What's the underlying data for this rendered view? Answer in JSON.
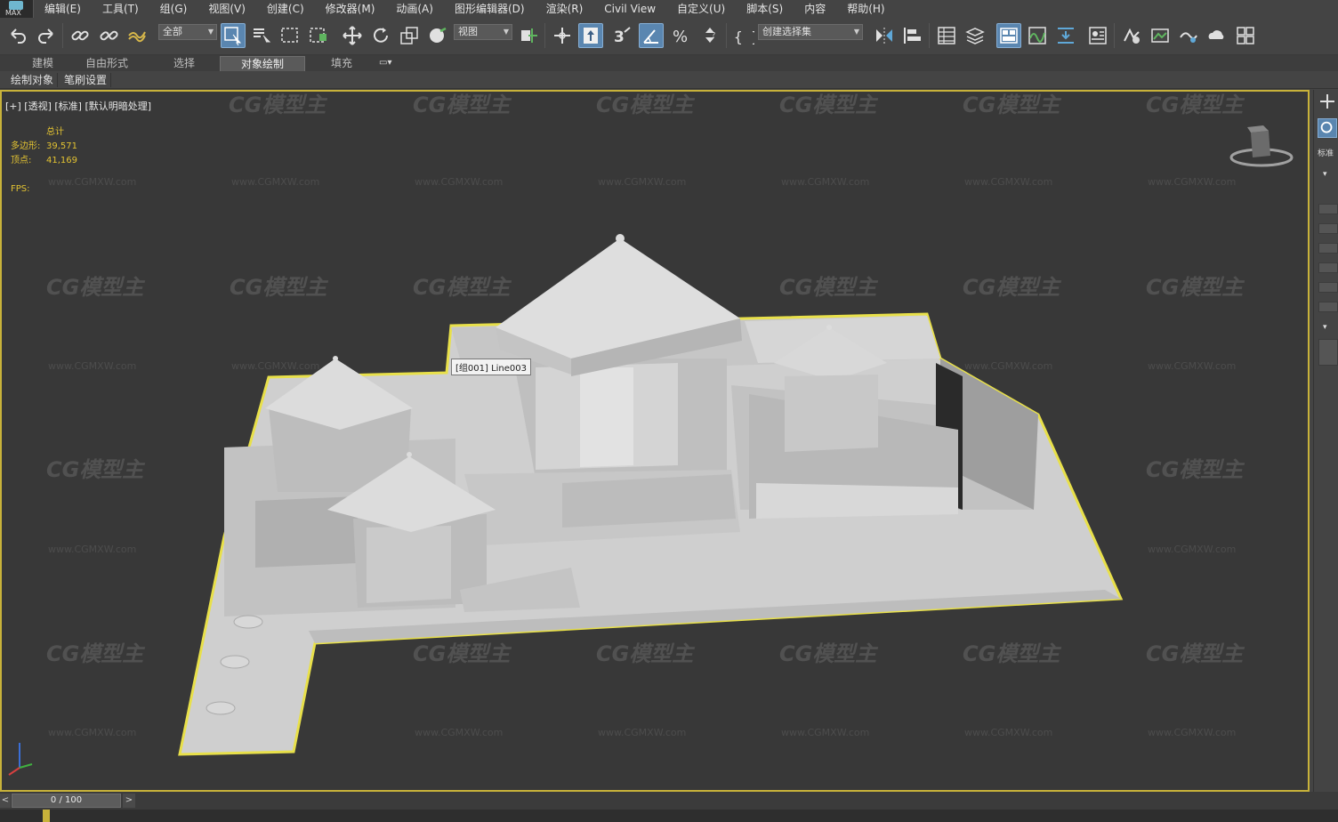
{
  "app": {
    "logo_text": "MAX"
  },
  "menu": [
    "编辑(E)",
    "工具(T)",
    "组(G)",
    "视图(V)",
    "创建(C)",
    "修改器(M)",
    "动画(A)",
    "图形编辑器(D)",
    "渲染(R)",
    "Civil View",
    "自定义(U)",
    "脚本(S)",
    "内容",
    "帮助(H)"
  ],
  "toolbar": {
    "selection_filter": "全部",
    "reference_coord": "视图",
    "named_selection": "创建选择集",
    "spinner_snap_label": "3"
  },
  "ribbon": {
    "tabs": [
      "建模",
      "自由形式",
      "选择",
      "对象绘制",
      "填充"
    ],
    "active_tab": "对象绘制"
  },
  "subribbon": {
    "items": [
      "绘制对象",
      "笔刷设置"
    ]
  },
  "viewport": {
    "label": "[+] [透视] [标准] [默认明暗处理]",
    "stats": {
      "header": "总计",
      "polys_label": "多边形:",
      "polys_value": "39,571",
      "verts_label": "顶点:",
      "verts_value": "41,169",
      "fps_label": "FPS:"
    },
    "tooltip": "[组001] Line003",
    "watermark_logo": "CG模型主",
    "watermark_url": "www.CGMXW.com",
    "selection_color": "#e8e04a",
    "model_color": "#c9c9c9"
  },
  "command_panel": {
    "label_short": "标准"
  },
  "timeline": {
    "frame_display": "0 / 100"
  }
}
